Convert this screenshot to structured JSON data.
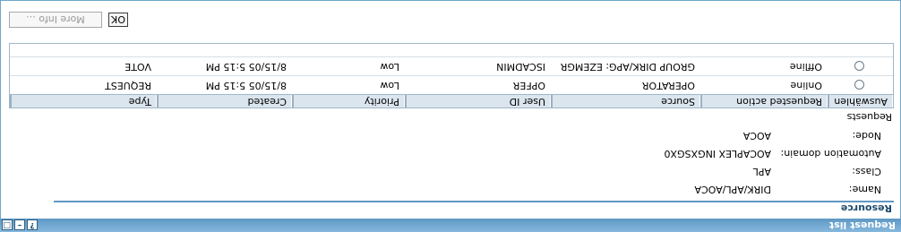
{
  "window": {
    "title": "Request list"
  },
  "resource": {
    "title": "Resource",
    "name_label": "Name:",
    "name_value": "DIRK/APL/AOCA",
    "class_label": "Class:",
    "class_value": "APL",
    "domain_label": "Automation domain:",
    "domain_value": "AOCAPLEX INGXSGX0",
    "node_label": "Node:",
    "node_value": "AOCA"
  },
  "requests": {
    "title": "Requests",
    "columns": [
      "Auswählen",
      "Requested action",
      "Source",
      "User ID",
      "Priority",
      "Created",
      "Type"
    ],
    "rows": [
      {
        "action": "Online",
        "source": "OPERATOR",
        "user": "OPFER",
        "priority": "Low",
        "created": "8/15/05 5:15 PM",
        "type": "REQUEST"
      },
      {
        "action": "Offline",
        "source": "GROUP DIRK/APG: EZEMGR",
        "user": "ISCADMIN",
        "priority": "Low",
        "created": "8/15/05 5:15 PM",
        "type": "VOTE"
      }
    ]
  },
  "buttons": {
    "ok": "OK",
    "more": "More Info ..."
  },
  "colors": {
    "titlebar": "#5f98c4",
    "accent": "#1c4b70"
  }
}
